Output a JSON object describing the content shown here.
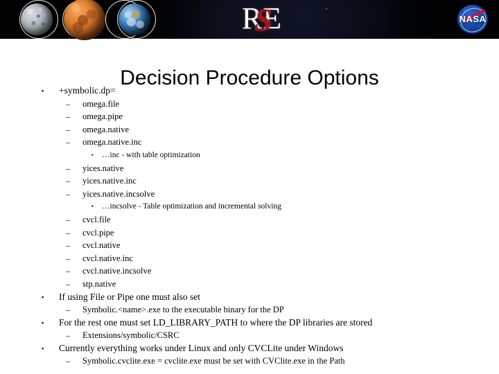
{
  "banner": {
    "planets": [
      {
        "name": "moon",
        "label": "moon-planet"
      },
      {
        "name": "mars",
        "label": "mars-planet"
      },
      {
        "name": "earth",
        "label": "earth-planet"
      }
    ],
    "logo": {
      "left_letter": "R",
      "right_letter": "E",
      "overlay_letter": "S",
      "overlay_color": "#9e1b1b",
      "text_color": "#ffffff"
    },
    "agency_logo": {
      "text": "NASA",
      "circle_color": "#14439c",
      "swoosh_color": "#d4122a"
    },
    "background_color": "#000000"
  },
  "slide": {
    "title": "Decision Procedure Options",
    "bullets": [
      {
        "level": 1,
        "marker": "▪",
        "text": "+symbolic.dp="
      },
      {
        "level": 2,
        "marker": "–",
        "text": "omega.file"
      },
      {
        "level": 2,
        "marker": "–",
        "text": "omega.pipe"
      },
      {
        "level": 2,
        "marker": "–",
        "text": "omega.native"
      },
      {
        "level": 2,
        "marker": "–",
        "text": "omega.native.inc"
      },
      {
        "level": 3,
        "marker": "▪",
        "text": "…inc - with table optimization"
      },
      {
        "level": 2,
        "marker": "–",
        "text": "yices.native"
      },
      {
        "level": 2,
        "marker": "–",
        "text": "yices.native.inc"
      },
      {
        "level": 2,
        "marker": "–",
        "text": "yices.native.incsolve"
      },
      {
        "level": 3,
        "marker": "▪",
        "text": "…incsolve - Table optimization and incremental solving"
      },
      {
        "level": 2,
        "marker": "–",
        "text": "cvcl.file"
      },
      {
        "level": 2,
        "marker": "–",
        "text": "cvcl.pipe"
      },
      {
        "level": 2,
        "marker": "–",
        "text": "cvcl.native"
      },
      {
        "level": 2,
        "marker": "–",
        "text": "cvcl.native.inc"
      },
      {
        "level": 2,
        "marker": "–",
        "text": "cvcl.native.incsolve"
      },
      {
        "level": 2,
        "marker": "–",
        "text": "stp.native"
      },
      {
        "level": 1,
        "marker": "▪",
        "text": "If using File or Pipe one must also set"
      },
      {
        "level": 2,
        "marker": "–",
        "text": "Symbolic.<name>.exe to the executable binary for the DP"
      },
      {
        "level": 1,
        "marker": "▪",
        "text": "For the rest one must set LD_LIBRARY_PATH to where the DP libraries are stored"
      },
      {
        "level": 2,
        "marker": "–",
        "text": "Extensions/symbolic/CSRC"
      },
      {
        "level": 1,
        "marker": "▪",
        "text": "Currently everything works under Linux and only CVCLite under Windows"
      },
      {
        "level": 2,
        "marker": "–",
        "text": "Symbolic.cvclite.exe = cvclite.exe must be set with CVClite.exe in the Path"
      }
    ]
  }
}
